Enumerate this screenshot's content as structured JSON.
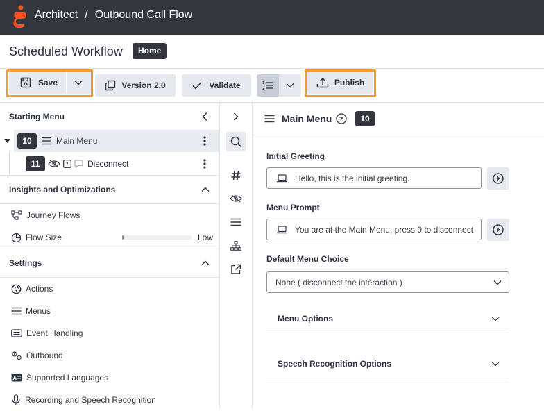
{
  "header": {
    "app_name": "Architect",
    "separator": "/",
    "flow_name": "Outbound Call Flow"
  },
  "subheader": {
    "title": "Scheduled Workflow",
    "home_label": "Home"
  },
  "toolbar": {
    "save_label": "Save",
    "version_label": "Version 2.0",
    "validate_label": "Validate",
    "publish_label": "Publish"
  },
  "left_panel": {
    "starting_menu": {
      "title": "Starting Menu",
      "items": [
        {
          "number": "10",
          "label": "Main Menu"
        },
        {
          "number": "11",
          "label": "Disconnect"
        }
      ]
    },
    "insights": {
      "title": "Insights and Optimizations",
      "items": [
        {
          "label": "Journey Flows"
        },
        {
          "label": "Flow Size",
          "value": "Low",
          "level": 0.02
        }
      ]
    },
    "settings": {
      "title": "Settings",
      "items": [
        {
          "label": "Actions",
          "icon": "globe-icon"
        },
        {
          "label": "Menus",
          "icon": "menu-icon"
        },
        {
          "label": "Event Handling",
          "icon": "event-icon"
        },
        {
          "label": "Outbound",
          "icon": "gears-icon"
        },
        {
          "label": "Supported Languages",
          "icon": "language-icon"
        },
        {
          "label": "Recording and Speech Recognition",
          "icon": "microphone-icon"
        }
      ]
    }
  },
  "main": {
    "title": "Main Menu",
    "number": "10",
    "initial_greeting": {
      "label": "Initial Greeting",
      "value": "Hello, this is the initial greeting."
    },
    "menu_prompt": {
      "label": "Menu Prompt",
      "value": "You are at the Main Menu, press 9 to disconnect"
    },
    "default_choice": {
      "label": "Default Menu Choice",
      "value": "None ( disconnect the interaction )"
    },
    "accordions": [
      {
        "label": "Menu Options"
      },
      {
        "label": "Speech Recognition Options"
      }
    ]
  },
  "colors": {
    "topbar": "#33373d",
    "brand": "#ff4f1f",
    "highlight": "#f39c2b",
    "button": "#e6e9ee"
  }
}
